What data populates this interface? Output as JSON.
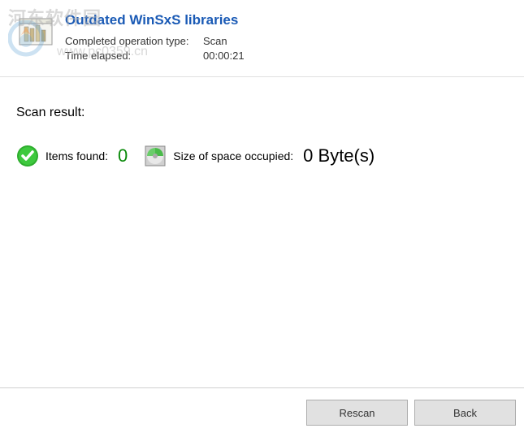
{
  "watermark": {
    "text": "河东软件园",
    "url": "www.pc0359.cn"
  },
  "header": {
    "title": "Outdated WinSxS libraries",
    "operation_label": "Completed operation type:",
    "operation_value": "Scan",
    "time_label": "Time elapsed:",
    "time_value": "00:00:21"
  },
  "content": {
    "scan_result_title": "Scan result:",
    "items_found_label": "Items found:",
    "items_found_value": "0",
    "size_label": "Size of space occupied:",
    "size_value": "0 Byte(s)"
  },
  "footer": {
    "rescan_label": "Rescan",
    "back_label": "Back"
  }
}
